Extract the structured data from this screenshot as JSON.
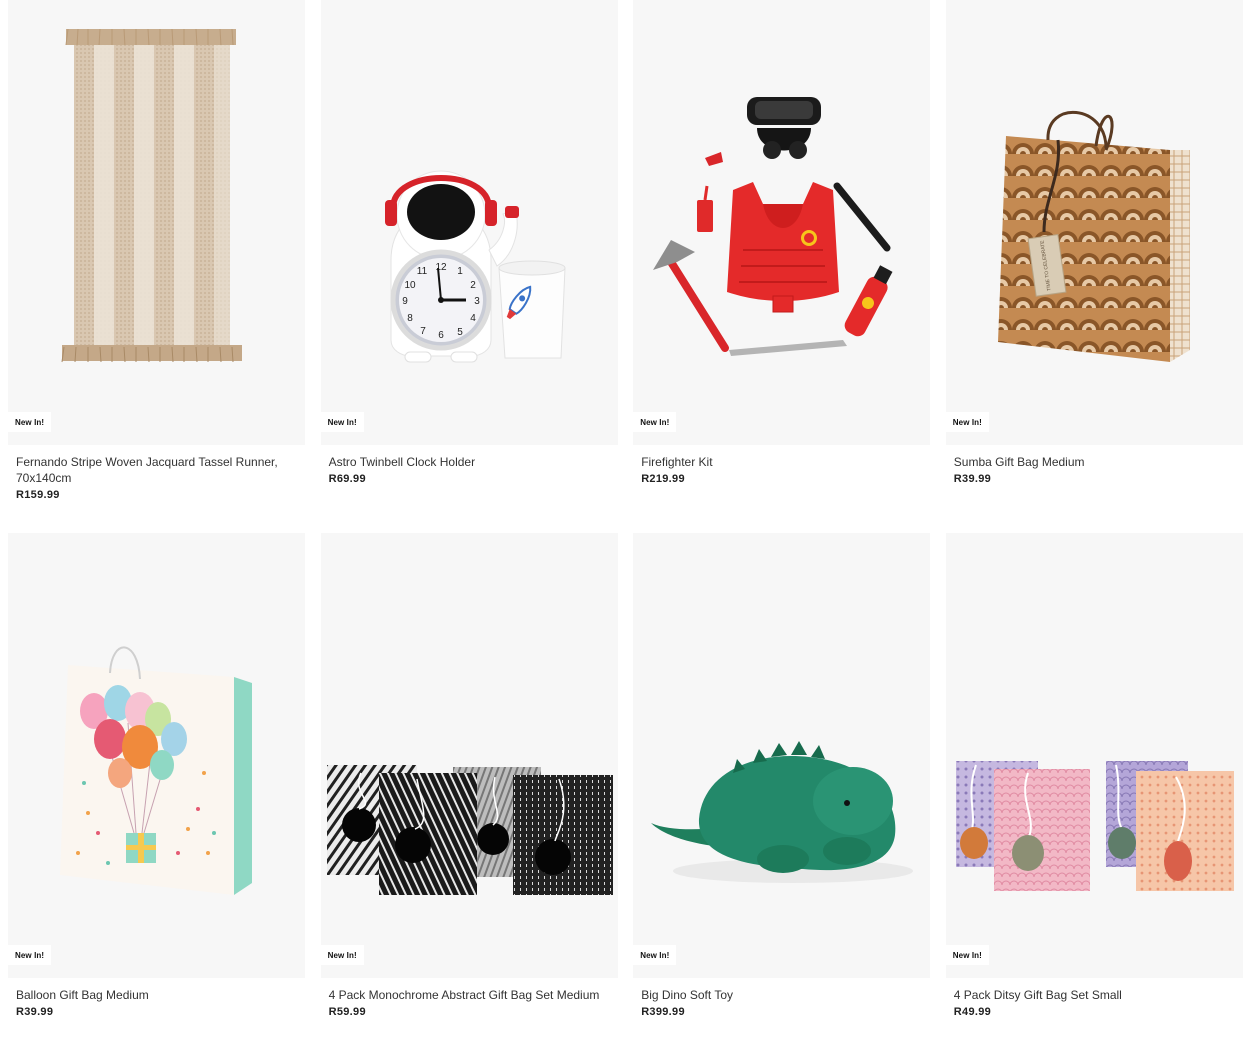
{
  "badge_label": "New In!",
  "products": [
    {
      "name": "Fernando Stripe Woven Jacquard Tassel Runner, 70x140cm",
      "price": "R159.99",
      "image": "tassel-runner-image"
    },
    {
      "name": "Astro Twinbell Clock Holder",
      "price": "R69.99",
      "image": "astronaut-clock-image"
    },
    {
      "name": "Firefighter Kit",
      "price": "R219.99",
      "image": "firefighter-kit-image"
    },
    {
      "name": "Sumba Gift Bag Medium",
      "price": "R39.99",
      "image": "sumba-gift-bag-image"
    },
    {
      "name": "Balloon Gift Bag Medium",
      "price": "R39.99",
      "image": "balloon-gift-bag-image"
    },
    {
      "name": "4 Pack Monochrome Abstract Gift Bag Set Medium",
      "price": "R59.99",
      "image": "monochrome-gift-bags-image"
    },
    {
      "name": "Big Dino Soft Toy",
      "price": "R399.99",
      "image": "dino-soft-toy-image"
    },
    {
      "name": "4 Pack Ditsy Gift Bag Set Small",
      "price": "R49.99",
      "image": "ditsy-gift-bags-image"
    }
  ],
  "clock_numbers": [
    "12",
    "1",
    "2",
    "3",
    "4",
    "5",
    "6",
    "7",
    "8",
    "9",
    "10",
    "11"
  ],
  "tag_text": "TIME TO CELEBRATE"
}
